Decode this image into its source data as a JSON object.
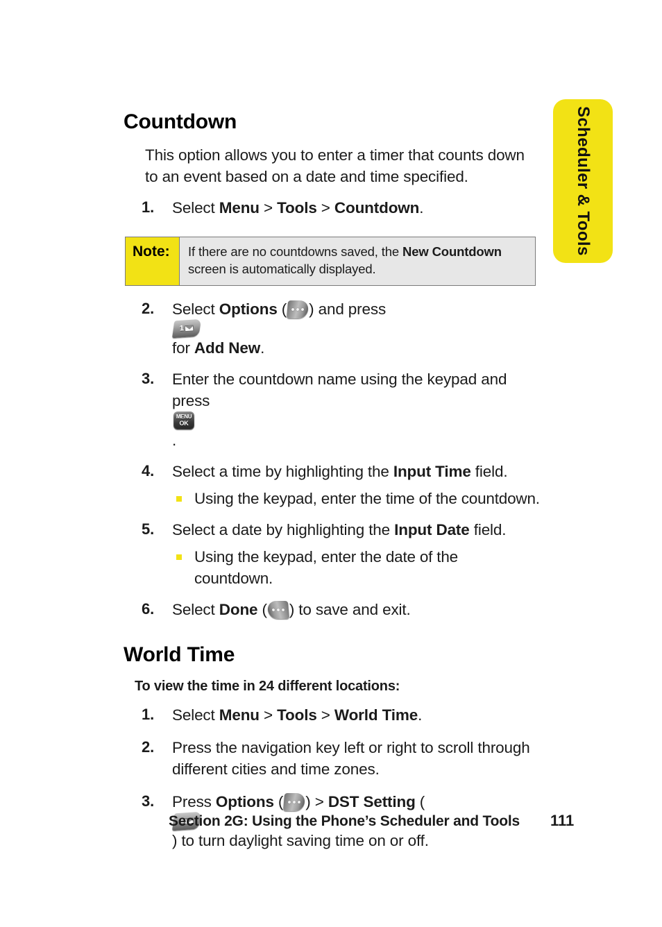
{
  "side_tab": {
    "label": "Scheduler & Tools",
    "color": "#F2E215"
  },
  "countdown": {
    "heading": "Countdown",
    "intro": "This option allows you to enter a timer that counts down to an event based on a date and time specified.",
    "step1": {
      "num": "1.",
      "lead": "Select ",
      "menu": "Menu",
      "sep1": " > ",
      "tools": "Tools",
      "sep2": " > ",
      "target": "Countdown",
      "end": "."
    },
    "note": {
      "label": "Note:",
      "text_before": "If there are no countdowns saved, the ",
      "text_bold": "New Countdown",
      "text_after": " screen is automatically displayed."
    },
    "step2": {
      "num": "2.",
      "a": "Select ",
      "options": "Options",
      "b": " (",
      "c": ") and press ",
      "d": " for ",
      "addnew": "Add New",
      "e": "."
    },
    "step3": {
      "num": "3.",
      "a": "Enter the countdown name using the keypad and press ",
      "b": "."
    },
    "step4": {
      "num": "4.",
      "a": "Select a time by highlighting the ",
      "field": "Input Time",
      "b": " field.",
      "sub": "Using the keypad, enter the time of the countdown."
    },
    "step5": {
      "num": "5.",
      "a": "Select a date by highlighting the ",
      "field": "Input Date",
      "b": " field.",
      "sub": "Using the keypad, enter the date of the countdown."
    },
    "step6": {
      "num": "6.",
      "a": "Select ",
      "done": "Done",
      "b": " (",
      "c": ") to save and exit."
    }
  },
  "world_time": {
    "heading": "World Time",
    "lead": "To view the time in 24 different locations:",
    "step1": {
      "num": "1.",
      "lead": "Select ",
      "menu": "Menu",
      "sep1": " > ",
      "tools": "Tools",
      "sep2": " > ",
      "target": "World Time",
      "end": "."
    },
    "step2": {
      "num": "2.",
      "text": "Press the navigation key left or right to scroll through different cities and time zones."
    },
    "step3": {
      "num": "3.",
      "a": "Press ",
      "options": "Options",
      "b": " (",
      "c": ") > ",
      "dst": "DST Setting",
      "d": " (",
      "e": ") to turn daylight saving time on or off."
    }
  },
  "footer": {
    "text": "Section 2G: Using the Phone’s Scheduler and Tools",
    "page": "111"
  },
  "icons": {
    "options_softkey": "right-softkey-icon",
    "done_softkey": "left-softkey-icon",
    "message_key": "message-key-icon",
    "menu_ok_key": "menu-ok-key-icon",
    "menu_ok_top": "MENU",
    "menu_ok_bottom": "OK",
    "message_digit": "1",
    "bullet": "yellow-square-bullet"
  }
}
